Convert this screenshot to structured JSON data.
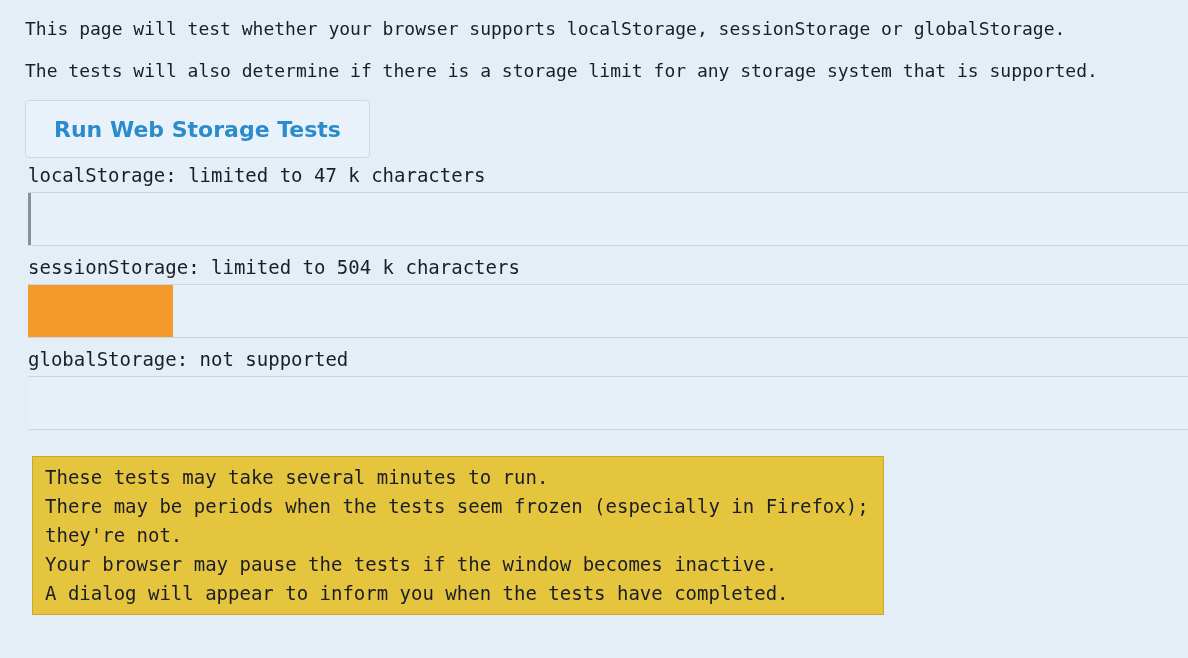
{
  "intro": [
    "This page will test whether your browser supports localStorage, sessionStorage or globalStorage.",
    "The tests will also determine if there is a storage limit for any storage system that is supported."
  ],
  "run_button": {
    "label": "Run Web Storage Tests"
  },
  "results": [
    {
      "label": "localStorage: limited to 47 k characters",
      "level": 0.003
    },
    {
      "label": "sessionStorage: limited to 504 k characters",
      "level": 0.125
    },
    {
      "label": "globalStorage: not supported"
    }
  ],
  "notes": [
    "These tests may take several minutes to run.",
    "There may be periods when the tests seem frozen (especially in Firefox); they're not.",
    "Your browser may pause the tests if the window becomes inactive.",
    "A dialog will appear to inform you when the tests have completed."
  ]
}
